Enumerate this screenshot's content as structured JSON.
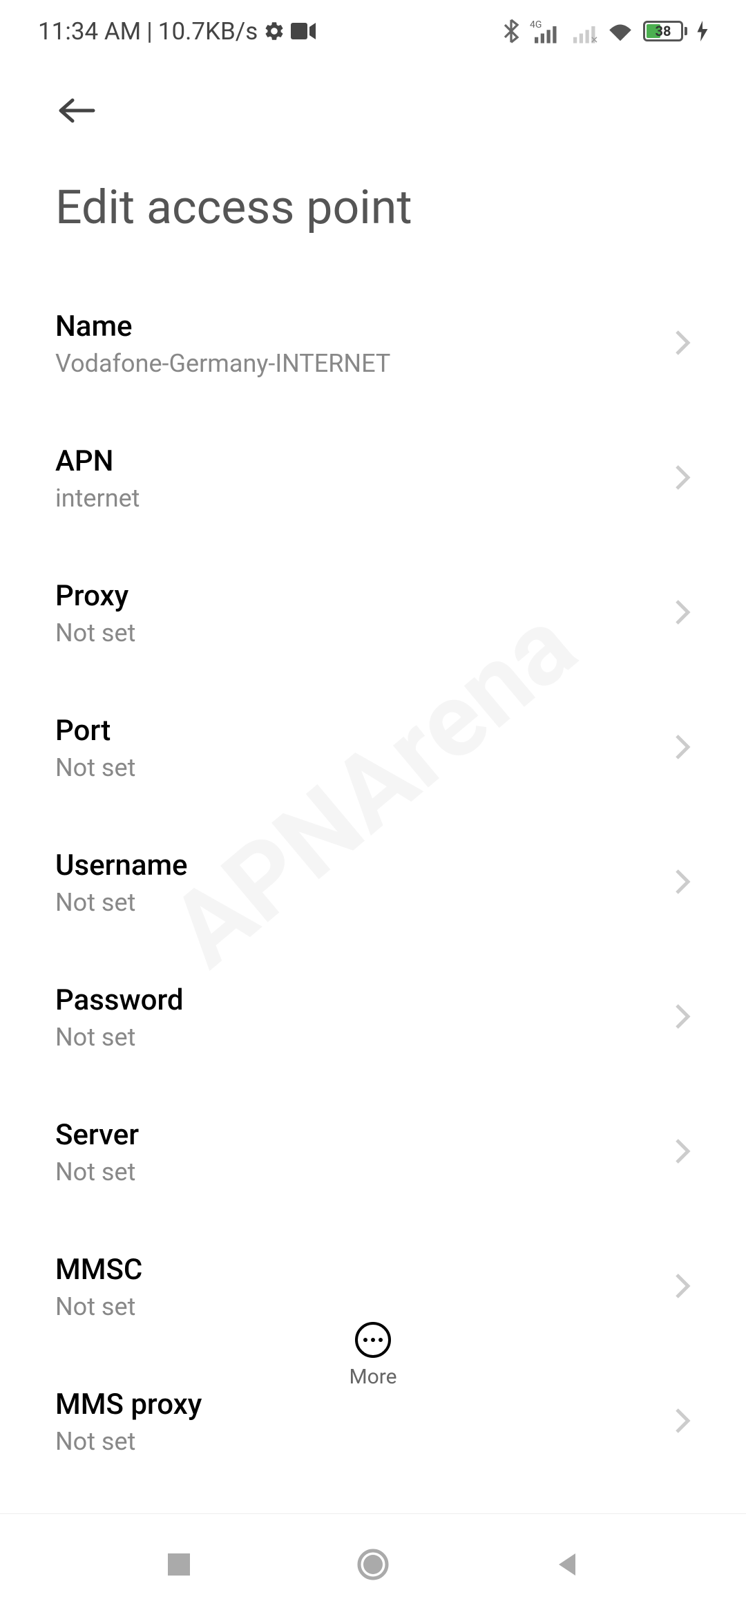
{
  "statusBar": {
    "time": "11:34 AM",
    "dataRate": "10.7KB/s",
    "batteryPercent": "38"
  },
  "header": {
    "title": "Edit access point"
  },
  "settings": [
    {
      "label": "Name",
      "value": "Vodafone-Germany-INTERNET"
    },
    {
      "label": "APN",
      "value": "internet"
    },
    {
      "label": "Proxy",
      "value": "Not set"
    },
    {
      "label": "Port",
      "value": "Not set"
    },
    {
      "label": "Username",
      "value": "Not set"
    },
    {
      "label": "Password",
      "value": "Not set"
    },
    {
      "label": "Server",
      "value": "Not set"
    },
    {
      "label": "MMSC",
      "value": "Not set"
    },
    {
      "label": "MMS proxy",
      "value": "Not set"
    }
  ],
  "bottomAction": {
    "moreLabel": "More"
  },
  "watermark": "APNArena"
}
